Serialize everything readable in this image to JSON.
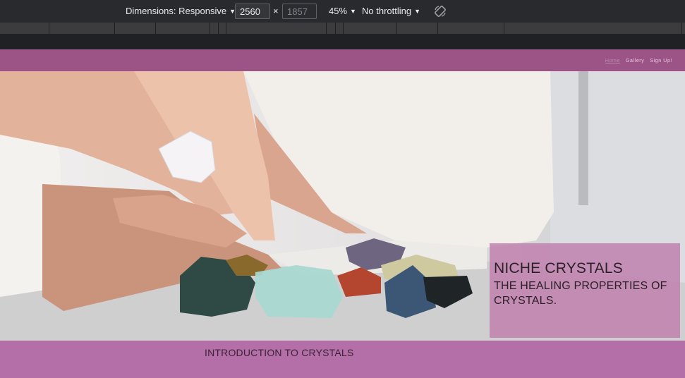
{
  "devtools": {
    "dimensions_label": "Dimensions: Responsive",
    "width_value": "2560",
    "times": "×",
    "height_value": "1857",
    "zoom": "45%",
    "throttling": "No throttling",
    "rotate_icon": "rotate-icon"
  },
  "site": {
    "nav": [
      {
        "label": "Home"
      },
      {
        "label": "Gallery"
      },
      {
        "label": "Sign Up!"
      }
    ],
    "hero": {
      "title": "NICHE CRYSTALS",
      "subtitle": "THE HEALING PROPERTIES OF CRYSTALS."
    },
    "intro_heading": "INTRODUCTION TO CRYSTALS"
  },
  "colors": {
    "header": "#9c5487",
    "page_bg": "#b56fa8",
    "card": "#be78aa"
  }
}
